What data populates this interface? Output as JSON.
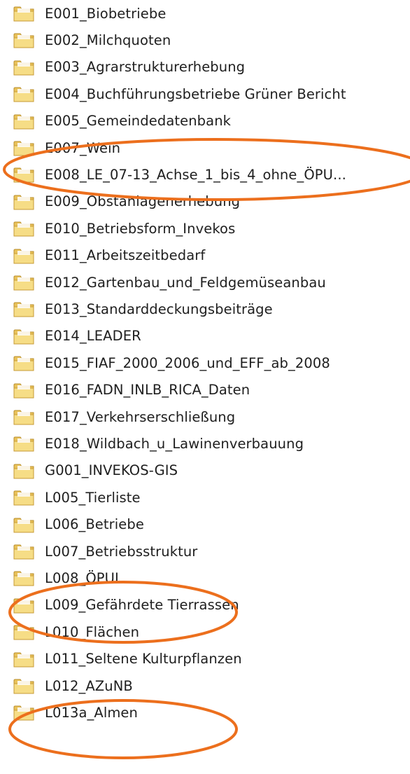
{
  "folders": [
    {
      "name": "E001_Biobetriebe"
    },
    {
      "name": "E002_Milchquoten"
    },
    {
      "name": "E003_Agrarstrukturerhebung"
    },
    {
      "name": "E004_Buchführungsbetriebe Grüner Bericht"
    },
    {
      "name": "E005_Gemeindedatenbank"
    },
    {
      "name": "E007_Wein"
    },
    {
      "name": "E008_LE_07-13_Achse_1_bis_4_ohne_ÖPU..."
    },
    {
      "name": "E009_Obstanlagenerhebung"
    },
    {
      "name": "E010_Betriebsform_Invekos"
    },
    {
      "name": "E011_Arbeitszeitbedarf"
    },
    {
      "name": "E012_Gartenbau_und_Feldgemüseanbau"
    },
    {
      "name": "E013_Standarddeckungsbeiträge"
    },
    {
      "name": "E014_LEADER"
    },
    {
      "name": "E015_FIAF_2000_2006_und_EFF_ab_2008"
    },
    {
      "name": "E016_FADN_INLB_RICA_Daten"
    },
    {
      "name": "E017_Verkehrserschließung"
    },
    {
      "name": "E018_Wildbach_u_Lawinenverbauung"
    },
    {
      "name": "G001_INVEKOS-GIS"
    },
    {
      "name": "L005_Tierliste"
    },
    {
      "name": "L006_Betriebe"
    },
    {
      "name": "L007_Betriebsstruktur"
    },
    {
      "name": "L008_ÖPUL"
    },
    {
      "name": "L009_Gefährdete Tierrassen"
    },
    {
      "name": "L010_Flächen"
    },
    {
      "name": "L011_Seltene Kulturpflanzen"
    },
    {
      "name": "L012_AZuNB"
    },
    {
      "name": "L013a_Almen"
    }
  ],
  "highlighted_folders": [
    "E008_LE_07-13_Achse_1_bis_4_ohne_ÖPU...",
    "L008_ÖPUL",
    "L012_AZuNB"
  ],
  "colors": {
    "highlight_ring": "#ec6f1d",
    "folder_body": "#e9c25a",
    "folder_front": "#f6dd86",
    "text": "#1e1e1e"
  }
}
